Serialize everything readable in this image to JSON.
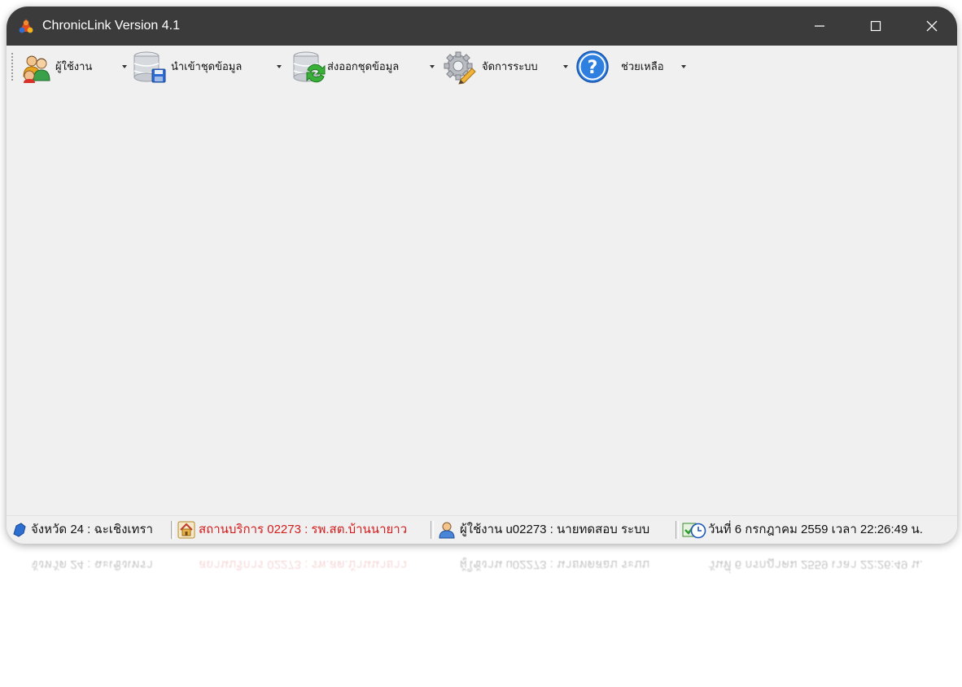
{
  "window": {
    "title": "ChronicLink Version 4.1",
    "colors": {
      "titlebar": "#3b3b3b",
      "body": "#f0f0f0",
      "accent_red": "#d21c1c"
    }
  },
  "toolbar": {
    "items": [
      {
        "label": "ผู้ใช้งาน",
        "icon": "users-icon",
        "has_dropdown": true
      },
      {
        "label": "นำเข้าชุดข้อมูล",
        "icon": "database-import-icon",
        "has_dropdown": true
      },
      {
        "label": "ส่งออกชุดข้อมูล",
        "icon": "database-export-icon",
        "has_dropdown": true
      },
      {
        "label": "จัดการระบบ",
        "icon": "gear-icon",
        "has_dropdown": true
      },
      {
        "label": "ช่วยเหลือ",
        "icon": "help-icon",
        "has_dropdown": true
      }
    ]
  },
  "statusbar": {
    "province": "จังหวัด 24 : ฉะเชิงเทรา",
    "facility": "สถานบริการ 02273 : รพ.สต.บ้านนายาว",
    "user": "ผู้ใช้งาน u02273 : นายทดสอบ  ระบบ",
    "datetime": "วันที่ 6 กรกฎาคม 2559 เวลา 22:26:49 น."
  }
}
